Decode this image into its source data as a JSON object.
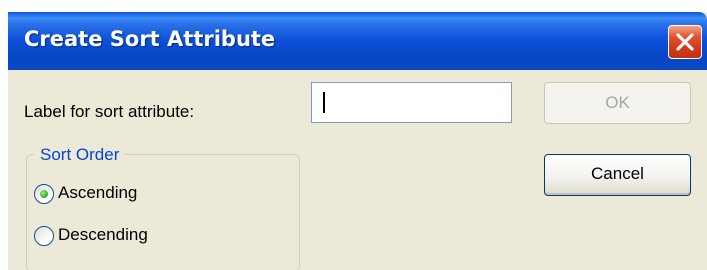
{
  "dialog": {
    "title": "Create Sort Attribute",
    "close_icon": "close-icon",
    "label_text": "Label for sort attribute:",
    "label_input_value": "",
    "ok_label": "OK",
    "ok_enabled": false,
    "cancel_label": "Cancel",
    "sort_order": {
      "legend": "Sort Order",
      "options": [
        {
          "label": "Ascending",
          "selected": true
        },
        {
          "label": "Descending",
          "selected": false
        }
      ]
    }
  },
  "colors": {
    "titlebar": "#0a4fd6",
    "window_bg": "#ece9d8",
    "close_button": "#d0391a",
    "group_legend": "#0046d5",
    "radio_selected": "#37b533",
    "disabled_text": "#a7a6aa"
  }
}
